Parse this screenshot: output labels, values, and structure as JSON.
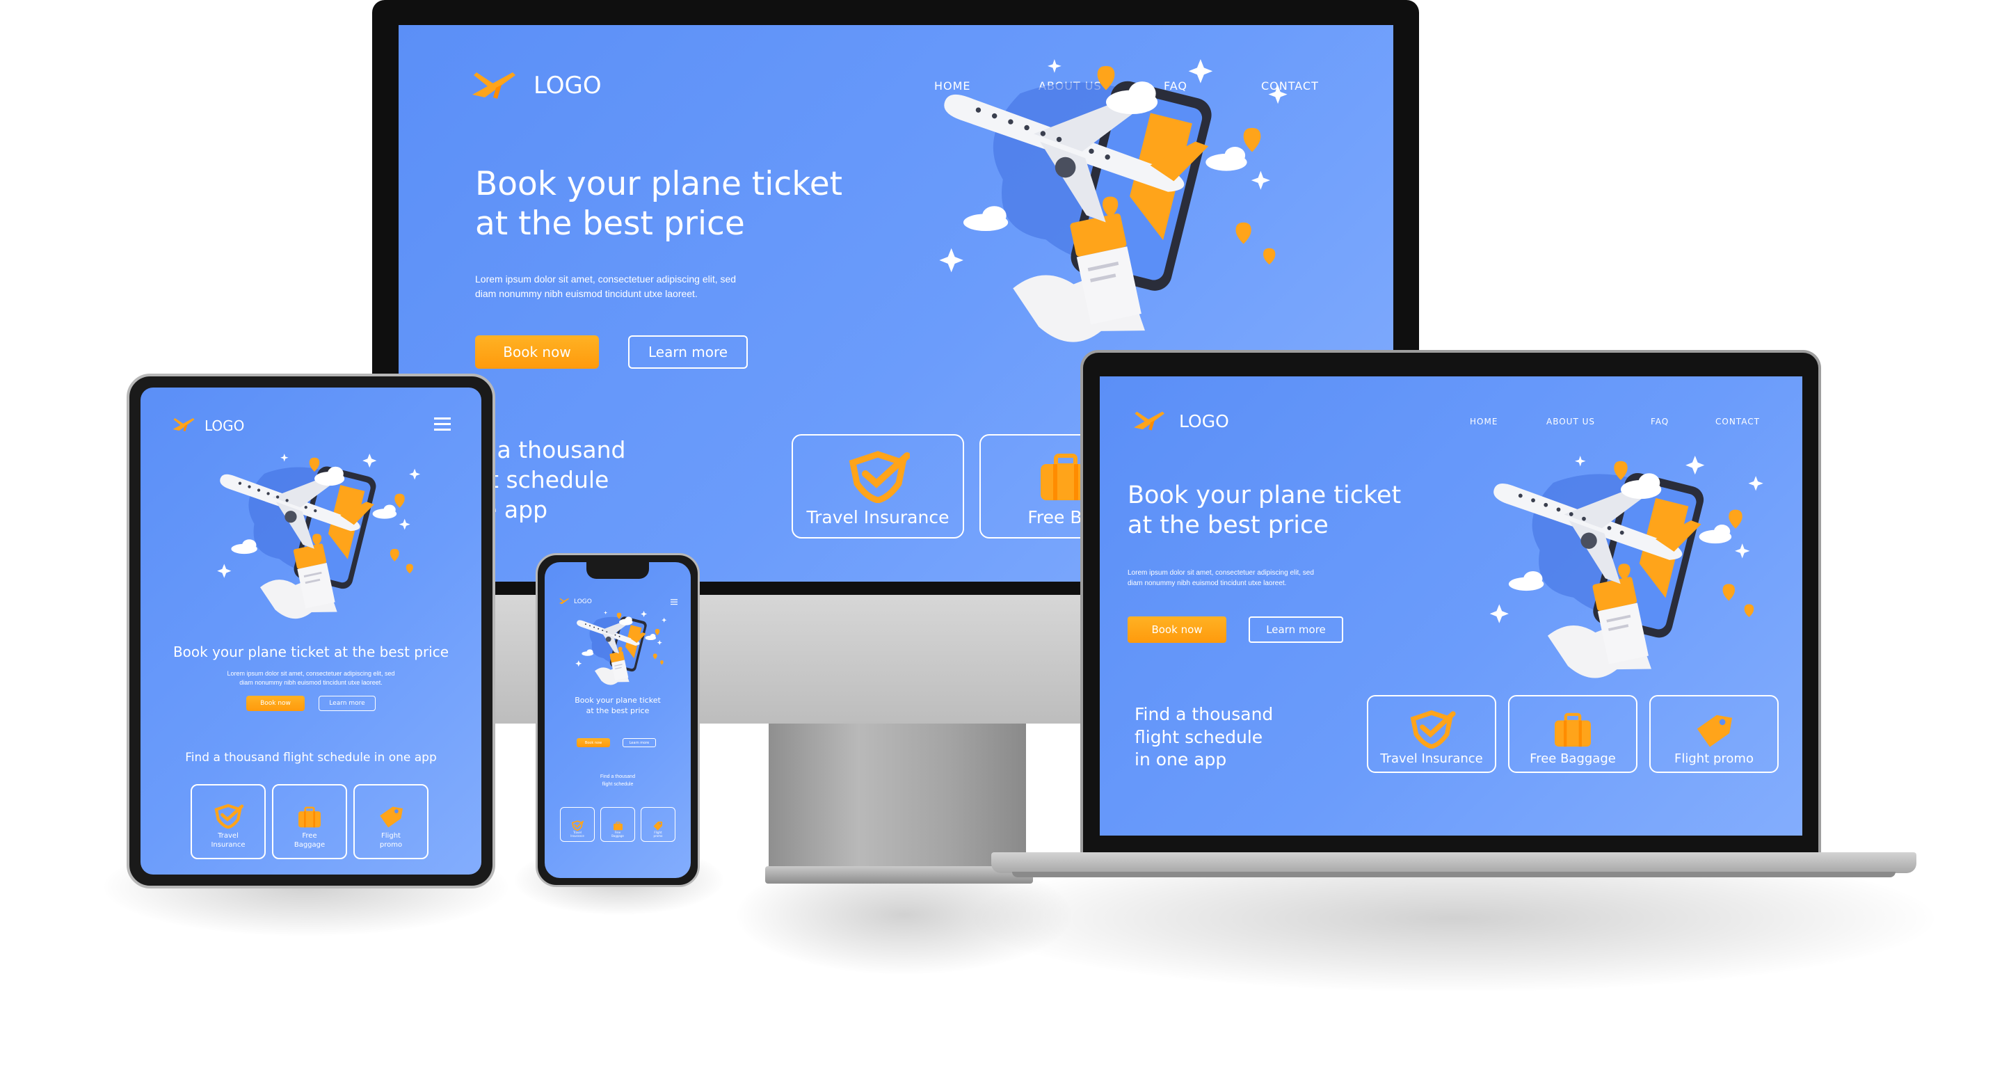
{
  "site": {
    "logo_text": "LOGO",
    "nav": [
      "HOME",
      "ABOUT US",
      "FAQ",
      "CONTACT"
    ],
    "hero_title_line1": "Book your plane ticket",
    "hero_title_line2": "at the best price",
    "hero_title_single": "Book your plane ticket at the best price",
    "hero_desc_line1": "Lorem ipsum dolor sit amet, consectetuer adipiscing elit, sed",
    "hero_desc_line2": "diam nonummy nibh euismod tincidunt utxe laoreet.",
    "book_now": "Book now",
    "learn_more": "Learn more",
    "find_line1": "Find a thousand",
    "find_line2": "flight schedule",
    "find_line3": "in one app",
    "find_single": "Find a thousand flight schedule in one app",
    "cards": [
      {
        "label": "Travel Insurance",
        "short1": "Travel",
        "short2": "Insurance",
        "icon": "shield-check-icon"
      },
      {
        "label": "Free Baggage",
        "short1": "Free",
        "short2": "Baggage",
        "icon": "suitcase-icon"
      },
      {
        "label": "Flight promo",
        "short1": "Flight",
        "short2": "promo",
        "icon": "price-tag-icon"
      }
    ]
  },
  "monitor_partial": {
    "find_line1": "ind a thousand",
    "find_line2": "ight schedule",
    "find_line3": " one app",
    "card2_label": "Free Bag"
  },
  "colors": {
    "screen_blue": "#5b8ff7",
    "accent_orange": "#ffa41a",
    "bezel": "#111111",
    "stand_gray": "#a8a8a8"
  }
}
